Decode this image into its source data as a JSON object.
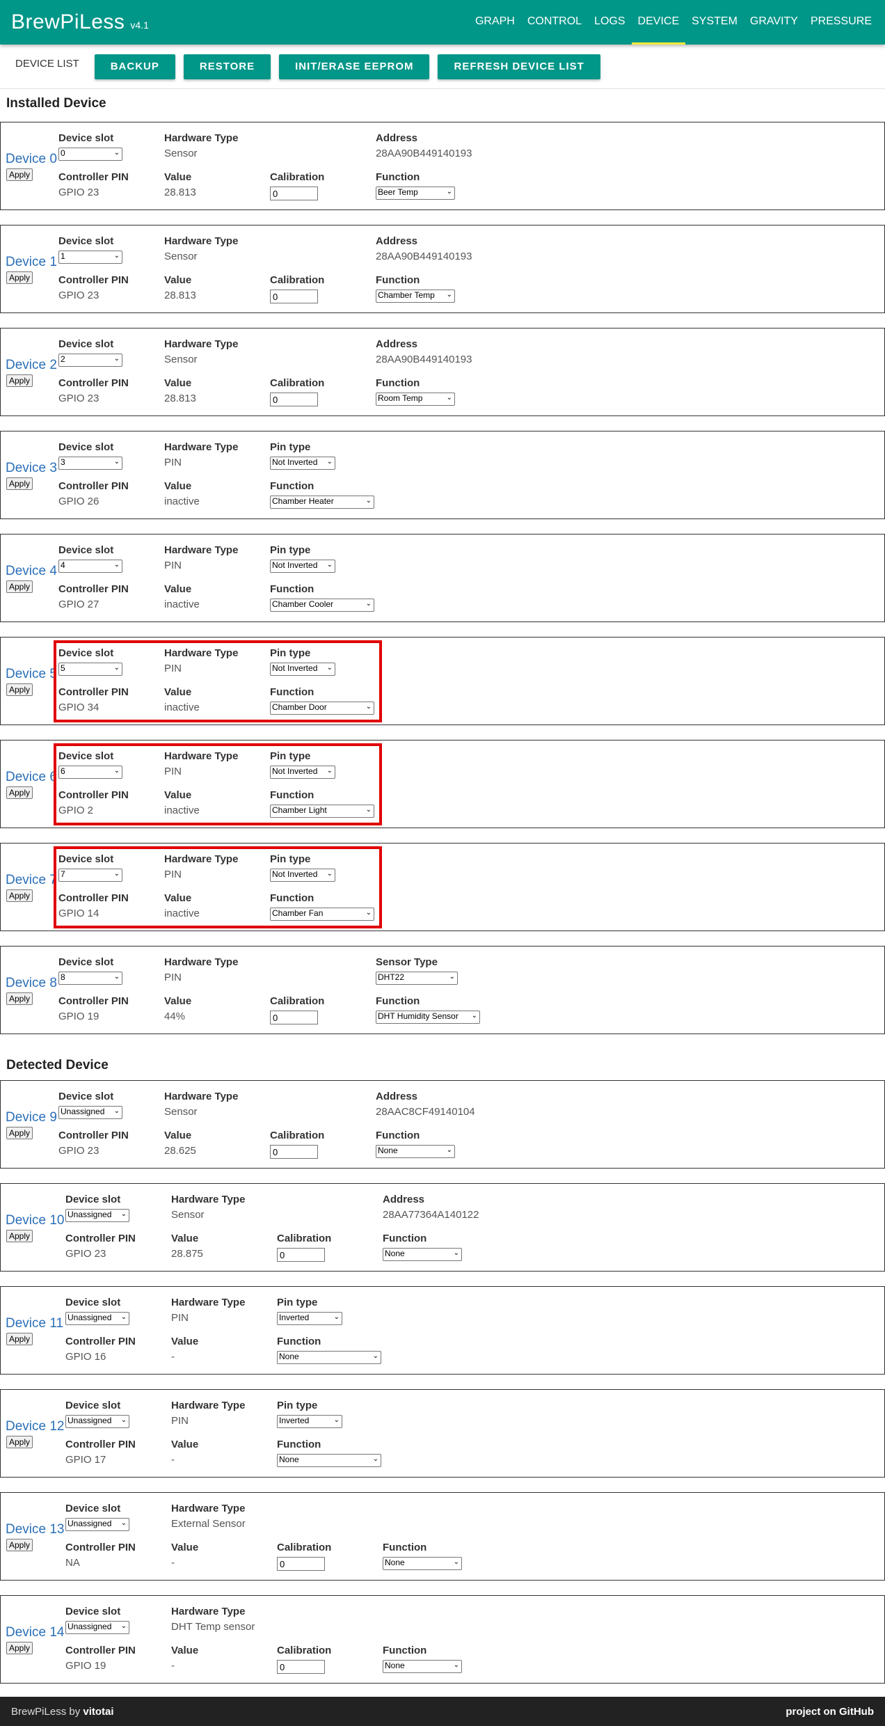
{
  "header": {
    "brand": "BrewPiLess",
    "version": "v4.1",
    "nav": [
      "GRAPH",
      "CONTROL",
      "LOGS",
      "DEVICE",
      "SYSTEM",
      "GRAVITY",
      "PRESSURE"
    ],
    "active_nav": "DEVICE"
  },
  "toolbar": {
    "label": "DEVICE LIST",
    "buttons": [
      "BACKUP",
      "RESTORE",
      "INIT/ERASE EEPROM",
      "REFRESH DEVICE LIST"
    ]
  },
  "sections": {
    "installed": "Installed Device",
    "detected": "Detected Device"
  },
  "labels": {
    "slot": "Device slot",
    "hw": "Hardware Type",
    "address": "Address",
    "pin_type": "Pin type",
    "sensor_type": "Sensor Type",
    "controller_pin": "Controller PIN",
    "value": "Value",
    "calibration": "Calibration",
    "function": "Function",
    "apply": "Apply"
  },
  "devices": [
    {
      "title": "Device 0",
      "slot": "0",
      "hw": "Sensor",
      "extra_kind": "address",
      "extra": "28AA90B449140193",
      "pin": "GPIO 23",
      "value": "28.813",
      "calibration": "0",
      "function": "Beer Temp"
    },
    {
      "title": "Device 1",
      "slot": "1",
      "hw": "Sensor",
      "extra_kind": "address",
      "extra": "28AA90B449140193",
      "pin": "GPIO 23",
      "value": "28.813",
      "calibration": "0",
      "function": "Chamber Temp"
    },
    {
      "title": "Device 2",
      "slot": "2",
      "hw": "Sensor",
      "extra_kind": "address",
      "extra": "28AA90B449140193",
      "pin": "GPIO 23",
      "value": "28.813",
      "calibration": "0",
      "function": "Room Temp"
    },
    {
      "title": "Device 3",
      "slot": "3",
      "hw": "PIN",
      "extra_kind": "pin_type",
      "extra": "Not Inverted",
      "pin": "GPIO 26",
      "value": "inactive",
      "function": "Chamber Heater"
    },
    {
      "title": "Device 4",
      "slot": "4",
      "hw": "PIN",
      "extra_kind": "pin_type",
      "extra": "Not Inverted",
      "pin": "GPIO 27",
      "value": "inactive",
      "function": "Chamber Cooler"
    },
    {
      "title": "Device 5",
      "slot": "5",
      "hw": "PIN",
      "extra_kind": "pin_type",
      "extra": "Not Inverted",
      "pin": "GPIO 34",
      "value": "inactive",
      "function": "Chamber Door",
      "highlighted": true
    },
    {
      "title": "Device 6",
      "slot": "6",
      "hw": "PIN",
      "extra_kind": "pin_type",
      "extra": "Not Inverted",
      "pin": "GPIO 2",
      "value": "inactive",
      "function": "Chamber Light",
      "highlighted": true
    },
    {
      "title": "Device 7",
      "slot": "7",
      "hw": "PIN",
      "extra_kind": "pin_type",
      "extra": "Not Inverted",
      "pin": "GPIO 14",
      "value": "inactive",
      "function": "Chamber Fan",
      "highlighted": true
    },
    {
      "title": "Device 8",
      "slot": "8",
      "hw": "PIN",
      "extra_kind": "sensor_type",
      "extra": "DHT22",
      "pin": "GPIO 19",
      "value": "44%",
      "calibration": "0",
      "function": "DHT Humidity Sensor"
    },
    {
      "title": "Device 9",
      "slot": "Unassigned",
      "hw": "Sensor",
      "extra_kind": "address",
      "extra": "28AAC8CF49140104",
      "pin": "GPIO 23",
      "value": "28.625",
      "calibration": "0",
      "function": "None"
    },
    {
      "title": "Device 10",
      "slot": "Unassigned",
      "hw": "Sensor",
      "extra_kind": "address",
      "extra": "28AA77364A140122",
      "pin": "GPIO 23",
      "value": "28.875",
      "calibration": "0",
      "function": "None"
    },
    {
      "title": "Device 11",
      "slot": "Unassigned",
      "hw": "PIN",
      "extra_kind": "pin_type",
      "extra": "Inverted",
      "pin": "GPIO 16",
      "value": "-",
      "function": "None"
    },
    {
      "title": "Device 12",
      "slot": "Unassigned",
      "hw": "PIN",
      "extra_kind": "pin_type",
      "extra": "Inverted",
      "pin": "GPIO 17",
      "value": "-",
      "function": "None"
    },
    {
      "title": "Device 13",
      "slot": "Unassigned",
      "hw": "External Sensor",
      "extra_kind": "none",
      "pin": "NA",
      "value": "-",
      "calibration": "0",
      "function": "None"
    },
    {
      "title": "Device 14",
      "slot": "Unassigned",
      "hw": "DHT Temp sensor",
      "extra_kind": "none",
      "pin": "GPIO 19",
      "value": "-",
      "calibration": "0",
      "function": "None"
    }
  ],
  "footer": {
    "left_prefix": "BrewPiLess by",
    "author": "vitotai",
    "right": "project on GitHub"
  }
}
